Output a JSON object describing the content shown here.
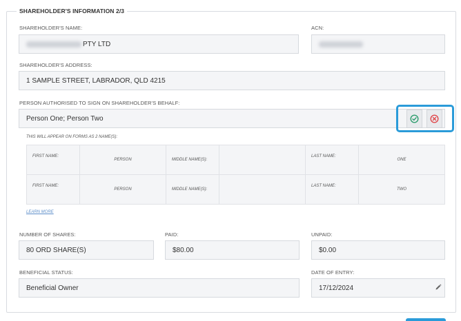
{
  "section": {
    "title": "SHAREHOLDER'S INFORMATION 2/3"
  },
  "shareholder_name": {
    "label": "SHAREHOLDER'S NAME:",
    "value": "PTY LTD"
  },
  "acn": {
    "label": "ACN:"
  },
  "address": {
    "label": "SHAREHOLDER'S ADDRESS:",
    "value": "1 SAMPLE STREET, LABRADOR, QLD 4215"
  },
  "authorised": {
    "label": "PERSON AUTHORISED TO SIGN ON SHAREHOLDER'S BEHALF:",
    "value": "Person One; Person Two",
    "confirm_icon": "check-circle-icon",
    "cancel_icon": "x-circle-icon",
    "accent": "#2a9bd9"
  },
  "names_note": "THIS WILL APPEAR ON FORMS AS 2 NAME(S):",
  "names_table": {
    "first_name_label": "FIRST NAME:",
    "middle_name_label": "MIDDLE NAME(S):",
    "last_name_label": "LAST NAME:",
    "rows": [
      {
        "first": "PERSON",
        "middle": "",
        "last": "ONE"
      },
      {
        "first": "PERSON",
        "middle": "",
        "last": "TWO"
      }
    ]
  },
  "learn_more": "LEARN MORE",
  "shares": {
    "label": "NUMBER OF SHARES:",
    "value": "80 ORD SHARE(S)"
  },
  "paid": {
    "label": "PAID:",
    "value": "$80.00"
  },
  "unpaid": {
    "label": "UNPAID:",
    "value": "$0.00"
  },
  "beneficial": {
    "label": "BENEFICIAL STATUS:",
    "value": "Beneficial Owner"
  },
  "date_of_entry": {
    "label": "DATE OF ENTRY:",
    "value": "17/12/2024",
    "icon": "pencil-icon"
  }
}
